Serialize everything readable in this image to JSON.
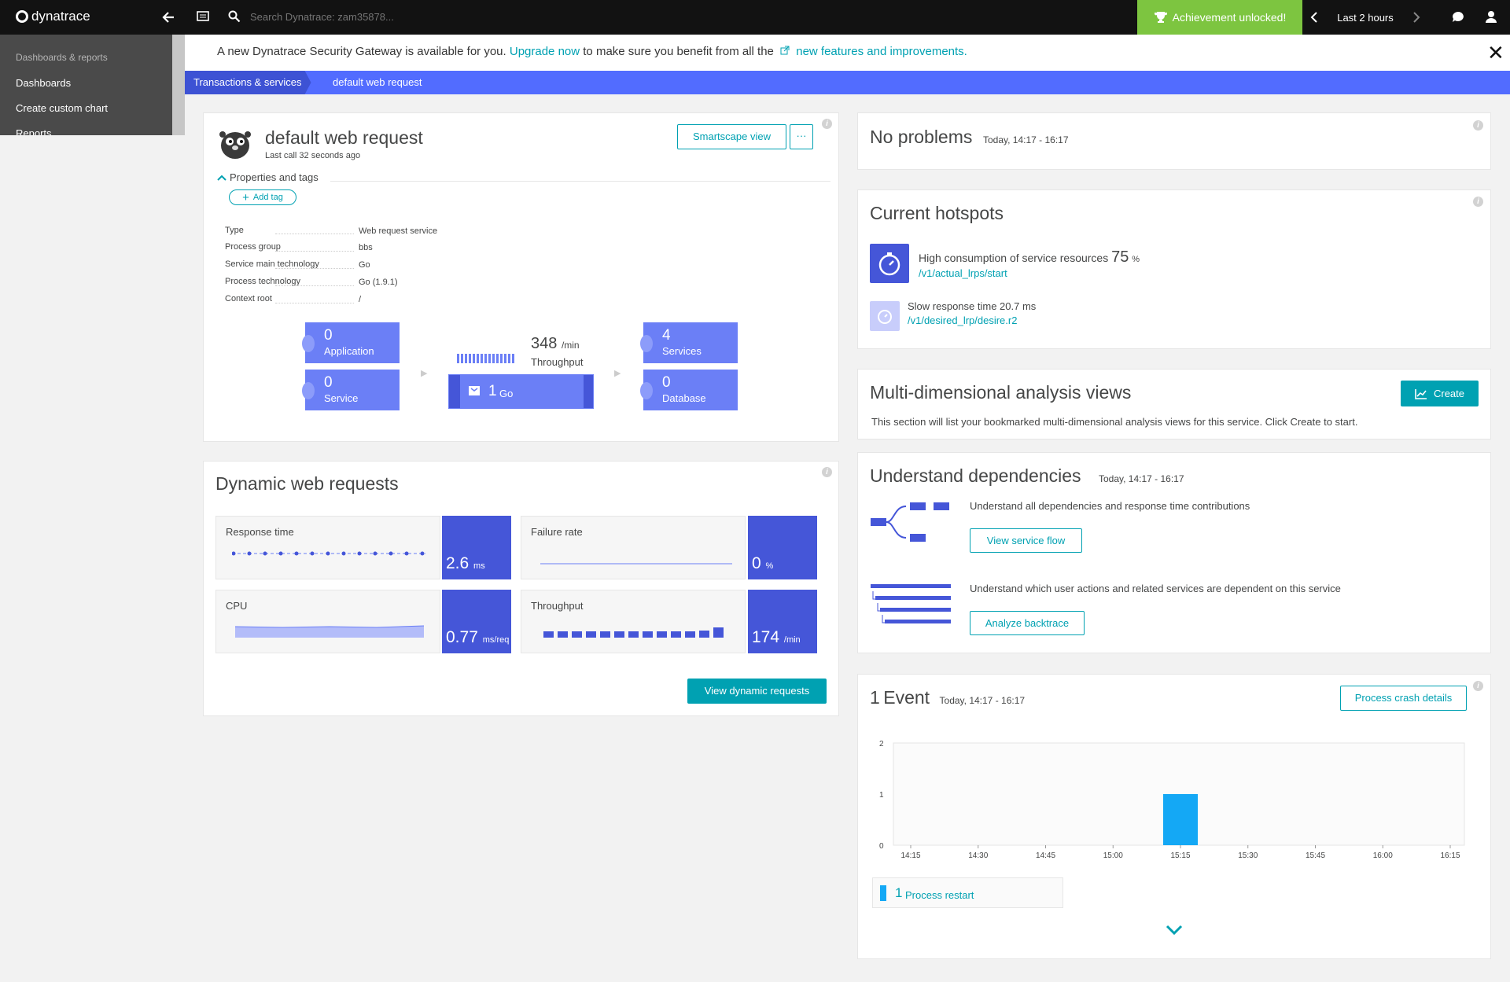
{
  "topbar": {
    "logo": "dynatrace",
    "search_placeholder": "Search Dynatrace: zam35878...",
    "achievement": "Achievement unlocked!",
    "timeframe": "Last 2 hours"
  },
  "sidebar": {
    "section": "Dashboards & reports",
    "items": [
      "Dashboards",
      "Create custom chart",
      "Reports"
    ]
  },
  "banner": {
    "text_before": "A new Dynatrace Security Gateway is available for you.",
    "link1": "Upgrade now",
    "text_middle": "to make sure you benefit from all the",
    "link2": "new features and improvements."
  },
  "breadcrumb": [
    "Transactions & services",
    "default web request"
  ],
  "service": {
    "title": "default web request",
    "last_call": "Last call 32 seconds ago",
    "smartscape_btn": "Smartscape view",
    "more_btn": "···",
    "props_toggle": "Properties and tags",
    "add_tag": "Add tag",
    "props": [
      {
        "k": "Type",
        "v": "Web request service"
      },
      {
        "k": "Process group",
        "v": "bbs"
      },
      {
        "k": "Service main technology",
        "v": "Go"
      },
      {
        "k": "Process technology",
        "v": "Go (1.9.1)"
      },
      {
        "k": "Context root",
        "v": "/"
      }
    ],
    "tiles": {
      "application": {
        "n": "0",
        "l": "Application"
      },
      "service": {
        "n": "0",
        "l": "Service"
      },
      "services": {
        "n": "4",
        "l": "Services"
      },
      "database": {
        "n": "0",
        "l": "Database"
      },
      "throughput_value": "348",
      "throughput_unit": "/min",
      "throughput_label": "Throughput",
      "process_count": "1",
      "process_label": "Go"
    }
  },
  "dynamic": {
    "title": "Dynamic web requests",
    "metrics": [
      {
        "t": "Response time",
        "v": "2.6",
        "u": "ms"
      },
      {
        "t": "Failure rate",
        "v": "0",
        "u": "%"
      },
      {
        "t": "CPU",
        "v": "0.77",
        "u": "ms/req"
      },
      {
        "t": "Throughput",
        "v": "174",
        "u": "/min"
      }
    ],
    "view_btn": "View dynamic requests"
  },
  "problems": {
    "title": "No problems",
    "time": "Today, 14:17 - 16:17"
  },
  "hotspots": {
    "title": "Current hotspots",
    "h1_text": "High consumption of service resources",
    "h1_value": "75",
    "h1_unit": "%",
    "h1_link": "/v1/actual_lrps/start",
    "h2_text": "Slow response time 20.7 ms",
    "h2_link": "/v1/desired_lrp/desire.r2"
  },
  "mda": {
    "title": "Multi-dimensional analysis views",
    "create": "Create",
    "text": "This section will list your bookmarked multi-dimensional analysis views for this service. Click Create to start."
  },
  "deps": {
    "title": "Understand dependencies",
    "time": "Today, 14:17 - 16:17",
    "t1": "Understand all dependencies and response time contributions",
    "b1": "View service flow",
    "t2": "Understand which user actions and related services are dependent on this service",
    "b2": "Analyze backtrace"
  },
  "events": {
    "count": "1",
    "title": "Event",
    "time": "Today, 14:17 - 16:17",
    "btn": "Process crash details",
    "legend_count": "1",
    "legend_label": "Process restart"
  },
  "chart_data": {
    "type": "bar",
    "categories": [
      "14:15",
      "14:30",
      "14:45",
      "15:00",
      "15:15",
      "15:30",
      "15:45",
      "16:00",
      "16:15"
    ],
    "values": [
      0,
      0,
      0,
      0,
      1,
      0,
      0,
      0,
      0
    ],
    "yticks": [
      "0",
      "1",
      "2"
    ],
    "ylim": [
      0,
      2
    ],
    "color": "#14a8f5"
  }
}
